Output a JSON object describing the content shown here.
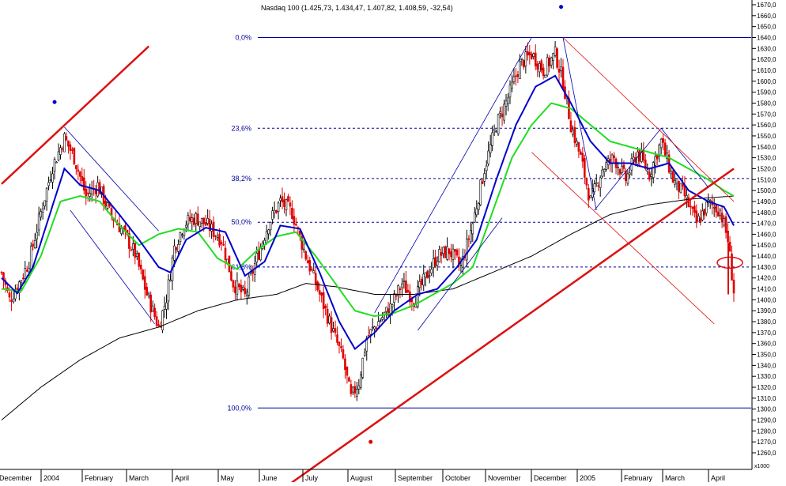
{
  "chart_data": {
    "type": "candlestick",
    "title": "Nasdaq 100 (1.425,73, 1.434,47, 1.407,82, 1.408,59, -32,54)",
    "y_ticks": [
      1260,
      1270,
      1280,
      1290,
      1300,
      1310,
      1320,
      1330,
      1340,
      1350,
      1360,
      1370,
      1380,
      1390,
      1400,
      1410,
      1420,
      1430,
      1440,
      1450,
      1460,
      1470,
      1480,
      1490,
      1500,
      1510,
      1520,
      1530,
      1540,
      1550,
      1560,
      1570,
      1580,
      1590,
      1600,
      1610,
      1620,
      1630,
      1640,
      1650,
      1660,
      1670
    ],
    "y_tick_labels": [
      "1260,0",
      "1270,0",
      "1280,0",
      "1290,0",
      "1300,0",
      "1310,0",
      "1320,0",
      "1330,0",
      "1340,0",
      "1350,0",
      "1360,0",
      "1370,0",
      "1380,0",
      "1390,0",
      "1400,0",
      "1410,0",
      "1420,0",
      "1430,0",
      "1440,0",
      "1450,0",
      "1460,0",
      "1470,0",
      "1480,0",
      "1490,0",
      "1500,0",
      "1510,0",
      "1520,0",
      "1530,0",
      "1540,0",
      "1550,0",
      "1560,0",
      "1570,0",
      "1580,0",
      "1590,0",
      "1600,0",
      "1610,0",
      "1620,0",
      "1630,0",
      "1640,0",
      "1650,0",
      "1660,0",
      "1670,0"
    ],
    "ylim": [
      1250,
      1678
    ],
    "x_month_labels": [
      "December",
      "2004",
      "February",
      "March",
      "April",
      "May",
      "June",
      "July",
      "August",
      "September",
      "October",
      "November",
      "December",
      "2005",
      "February",
      "March",
      "April"
    ],
    "x_extra_label": "x1000",
    "fib_levels": [
      {
        "label": "0,0%",
        "value": 1640
      },
      {
        "label": "23,6%",
        "value": 1557
      },
      {
        "label": "38,2%",
        "value": 1511
      },
      {
        "label": "50,0%",
        "value": 1471
      },
      {
        "label": "61,8%",
        "value": 1430
      },
      {
        "label": "100,0%",
        "value": 1301
      }
    ],
    "series_colors": {
      "candle": "#e00000",
      "ma_short": "#0000cc",
      "ma_mid": "#22dd22",
      "ma_long": "#000000",
      "trendline": "#dd1111",
      "channel": "#0000aa",
      "fib": "#000099"
    },
    "close_path": [
      {
        "i": 0,
        "v": 1425
      },
      {
        "i": 4,
        "v": 1400
      },
      {
        "i": 8,
        "v": 1412
      },
      {
        "i": 14,
        "v": 1435
      },
      {
        "i": 20,
        "v": 1480
      },
      {
        "i": 26,
        "v": 1522
      },
      {
        "i": 32,
        "v": 1548
      },
      {
        "i": 37,
        "v": 1530
      },
      {
        "i": 43,
        "v": 1495
      },
      {
        "i": 49,
        "v": 1505
      },
      {
        "i": 55,
        "v": 1480
      },
      {
        "i": 62,
        "v": 1462
      },
      {
        "i": 68,
        "v": 1442
      },
      {
        "i": 74,
        "v": 1405
      },
      {
        "i": 80,
        "v": 1375
      },
      {
        "i": 84,
        "v": 1402
      },
      {
        "i": 88,
        "v": 1448
      },
      {
        "i": 93,
        "v": 1470
      },
      {
        "i": 99,
        "v": 1475
      },
      {
        "i": 105,
        "v": 1468
      },
      {
        "i": 112,
        "v": 1455
      },
      {
        "i": 118,
        "v": 1415
      },
      {
        "i": 124,
        "v": 1403
      },
      {
        "i": 130,
        "v": 1438
      },
      {
        "i": 136,
        "v": 1470
      },
      {
        "i": 142,
        "v": 1490
      },
      {
        "i": 148,
        "v": 1480
      },
      {
        "i": 155,
        "v": 1440
      },
      {
        "i": 162,
        "v": 1405
      },
      {
        "i": 168,
        "v": 1375
      },
      {
        "i": 174,
        "v": 1345
      },
      {
        "i": 178,
        "v": 1310
      },
      {
        "i": 182,
        "v": 1325
      },
      {
        "i": 186,
        "v": 1365
      },
      {
        "i": 192,
        "v": 1380
      },
      {
        "i": 198,
        "v": 1393
      },
      {
        "i": 204,
        "v": 1415
      },
      {
        "i": 210,
        "v": 1400
      },
      {
        "i": 216,
        "v": 1420
      },
      {
        "i": 222,
        "v": 1440
      },
      {
        "i": 228,
        "v": 1445
      },
      {
        "i": 234,
        "v": 1430
      },
      {
        "i": 240,
        "v": 1470
      },
      {
        "i": 246,
        "v": 1520
      },
      {
        "i": 252,
        "v": 1560
      },
      {
        "i": 258,
        "v": 1585
      },
      {
        "i": 264,
        "v": 1615
      },
      {
        "i": 270,
        "v": 1625
      },
      {
        "i": 276,
        "v": 1610
      },
      {
        "i": 282,
        "v": 1625
      },
      {
        "i": 286,
        "v": 1600
      },
      {
        "i": 290,
        "v": 1560
      },
      {
        "i": 295,
        "v": 1530
      },
      {
        "i": 300,
        "v": 1490
      },
      {
        "i": 306,
        "v": 1520
      },
      {
        "i": 312,
        "v": 1530
      },
      {
        "i": 318,
        "v": 1510
      },
      {
        "i": 324,
        "v": 1535
      },
      {
        "i": 330,
        "v": 1515
      },
      {
        "i": 336,
        "v": 1545
      },
      {
        "i": 342,
        "v": 1510
      },
      {
        "i": 348,
        "v": 1495
      },
      {
        "i": 354,
        "v": 1470
      },
      {
        "i": 360,
        "v": 1488
      },
      {
        "i": 366,
        "v": 1482
      },
      {
        "i": 370,
        "v": 1455
      },
      {
        "i": 373,
        "v": 1408
      }
    ],
    "ma_short_path": [
      {
        "i": 0,
        "v": 1420
      },
      {
        "i": 8,
        "v": 1406
      },
      {
        "i": 16,
        "v": 1430
      },
      {
        "i": 24,
        "v": 1475
      },
      {
        "i": 32,
        "v": 1520
      },
      {
        "i": 40,
        "v": 1505
      },
      {
        "i": 50,
        "v": 1500
      },
      {
        "i": 60,
        "v": 1478
      },
      {
        "i": 70,
        "v": 1455
      },
      {
        "i": 80,
        "v": 1430
      },
      {
        "i": 86,
        "v": 1425
      },
      {
        "i": 94,
        "v": 1455
      },
      {
        "i": 104,
        "v": 1466
      },
      {
        "i": 114,
        "v": 1462
      },
      {
        "i": 124,
        "v": 1422
      },
      {
        "i": 134,
        "v": 1435
      },
      {
        "i": 142,
        "v": 1468
      },
      {
        "i": 152,
        "v": 1465
      },
      {
        "i": 162,
        "v": 1425
      },
      {
        "i": 172,
        "v": 1380
      },
      {
        "i": 180,
        "v": 1355
      },
      {
        "i": 190,
        "v": 1370
      },
      {
        "i": 200,
        "v": 1390
      },
      {
        "i": 212,
        "v": 1405
      },
      {
        "i": 222,
        "v": 1410
      },
      {
        "i": 232,
        "v": 1430
      },
      {
        "i": 242,
        "v": 1455
      },
      {
        "i": 252,
        "v": 1510
      },
      {
        "i": 262,
        "v": 1560
      },
      {
        "i": 272,
        "v": 1595
      },
      {
        "i": 282,
        "v": 1605
      },
      {
        "i": 290,
        "v": 1580
      },
      {
        "i": 300,
        "v": 1545
      },
      {
        "i": 310,
        "v": 1525
      },
      {
        "i": 320,
        "v": 1525
      },
      {
        "i": 330,
        "v": 1520
      },
      {
        "i": 340,
        "v": 1525
      },
      {
        "i": 350,
        "v": 1500
      },
      {
        "i": 360,
        "v": 1490
      },
      {
        "i": 368,
        "v": 1485
      },
      {
        "i": 373,
        "v": 1468
      }
    ],
    "ma_mid_path": [
      {
        "i": 0,
        "v": 1410
      },
      {
        "i": 10,
        "v": 1408
      },
      {
        "i": 20,
        "v": 1440
      },
      {
        "i": 30,
        "v": 1490
      },
      {
        "i": 40,
        "v": 1495
      },
      {
        "i": 50,
        "v": 1490
      },
      {
        "i": 60,
        "v": 1468
      },
      {
        "i": 70,
        "v": 1450
      },
      {
        "i": 80,
        "v": 1460
      },
      {
        "i": 90,
        "v": 1465
      },
      {
        "i": 100,
        "v": 1462
      },
      {
        "i": 110,
        "v": 1438
      },
      {
        "i": 120,
        "v": 1428
      },
      {
        "i": 130,
        "v": 1445
      },
      {
        "i": 140,
        "v": 1458
      },
      {
        "i": 150,
        "v": 1462
      },
      {
        "i": 160,
        "v": 1440
      },
      {
        "i": 170,
        "v": 1415
      },
      {
        "i": 180,
        "v": 1390
      },
      {
        "i": 190,
        "v": 1385
      },
      {
        "i": 200,
        "v": 1388
      },
      {
        "i": 210,
        "v": 1395
      },
      {
        "i": 220,
        "v": 1405
      },
      {
        "i": 230,
        "v": 1415
      },
      {
        "i": 240,
        "v": 1430
      },
      {
        "i": 250,
        "v": 1480
      },
      {
        "i": 260,
        "v": 1530
      },
      {
        "i": 270,
        "v": 1560
      },
      {
        "i": 280,
        "v": 1580
      },
      {
        "i": 290,
        "v": 1575
      },
      {
        "i": 300,
        "v": 1560
      },
      {
        "i": 310,
        "v": 1545
      },
      {
        "i": 320,
        "v": 1540
      },
      {
        "i": 330,
        "v": 1535
      },
      {
        "i": 340,
        "v": 1530
      },
      {
        "i": 350,
        "v": 1520
      },
      {
        "i": 360,
        "v": 1510
      },
      {
        "i": 368,
        "v": 1500
      },
      {
        "i": 373,
        "v": 1495
      }
    ],
    "ma_long_path": [
      {
        "i": 0,
        "v": 1290
      },
      {
        "i": 20,
        "v": 1320
      },
      {
        "i": 40,
        "v": 1345
      },
      {
        "i": 60,
        "v": 1365
      },
      {
        "i": 80,
        "v": 1375
      },
      {
        "i": 100,
        "v": 1390
      },
      {
        "i": 120,
        "v": 1400
      },
      {
        "i": 140,
        "v": 1405
      },
      {
        "i": 155,
        "v": 1415
      },
      {
        "i": 170,
        "v": 1412
      },
      {
        "i": 190,
        "v": 1405
      },
      {
        "i": 210,
        "v": 1405
      },
      {
        "i": 230,
        "v": 1410
      },
      {
        "i": 250,
        "v": 1425
      },
      {
        "i": 270,
        "v": 1440
      },
      {
        "i": 290,
        "v": 1460
      },
      {
        "i": 310,
        "v": 1478
      },
      {
        "i": 330,
        "v": 1487
      },
      {
        "i": 350,
        "v": 1492
      },
      {
        "i": 373,
        "v": 1495
      }
    ],
    "trendlines": [
      {
        "x1": 0,
        "v1": 1506,
        "x2": 75,
        "v2": 1632
      },
      {
        "x1": 130,
        "v1": 1210,
        "x2": 373,
        "v2": 1520
      }
    ],
    "channels": [
      {
        "x1": 32,
        "v1": 1558,
        "x2": 80,
        "v2": 1463
      },
      {
        "x1": 35,
        "v1": 1482,
        "x2": 78,
        "v2": 1378
      },
      {
        "x1": 190,
        "v1": 1388,
        "x2": 270,
        "v2": 1640
      },
      {
        "x1": 212,
        "v1": 1372,
        "x2": 255,
        "v2": 1475
      },
      {
        "x1": 286,
        "v1": 1640,
        "x2": 303,
        "v2": 1482
      },
      {
        "x1": 302,
        "v1": 1482,
        "x2": 336,
        "v2": 1557
      },
      {
        "x1": 336,
        "v1": 1557,
        "x2": 360,
        "v2": 1503
      }
    ],
    "red_channel": [
      {
        "x1": 286,
        "v1": 1640,
        "x2": 373,
        "v2": 1490
      },
      {
        "x1": 270,
        "v1": 1535,
        "x2": 363,
        "v2": 1378
      }
    ],
    "markers": [
      {
        "type": "dot",
        "color": "#0000cc",
        "i": 27,
        "v": 1581
      },
      {
        "type": "dot",
        "color": "#0000cc",
        "i": 285,
        "v": 1668
      },
      {
        "type": "dot",
        "color": "#dd0000",
        "i": 188,
        "v": 1270
      }
    ]
  }
}
